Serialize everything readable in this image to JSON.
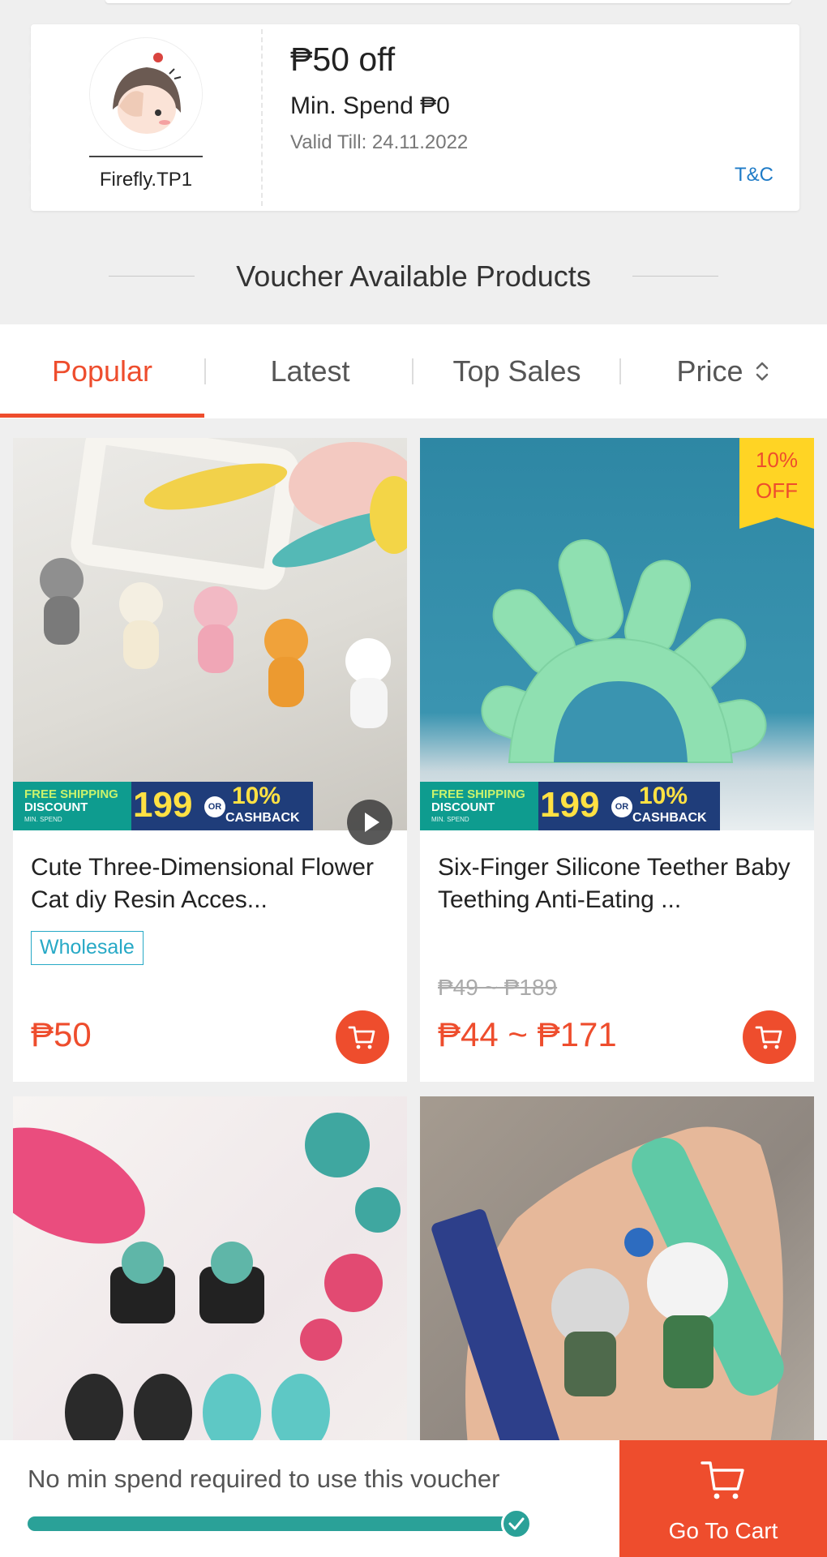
{
  "voucher": {
    "shop_name": "Firefly.TP1",
    "title": "₱50 off",
    "min_spend": "Min. Spend ₱0",
    "valid_till": "Valid Till: 24.11.2022",
    "tnc": "T&C"
  },
  "section": {
    "title": "Voucher Available Products"
  },
  "tabs": {
    "items": [
      {
        "label": "Popular",
        "active": true
      },
      {
        "label": "Latest",
        "active": false
      },
      {
        "label": "Top Sales",
        "active": false
      },
      {
        "label": "Price",
        "active": false
      }
    ],
    "price_icon": "sort-updown-icon"
  },
  "promo_banner": {
    "free_shipping": "FREE SHIPPING",
    "discount": "DISCOUNT",
    "min_spend": "MIN. SPEND",
    "amount": "199",
    "or": "OR",
    "percent": "10%",
    "cashback": "CASHBACK"
  },
  "products": [
    {
      "name": "Cute Three-Dimensional Flower Cat diy Resin Acces...",
      "tag": "Wholesale",
      "price": "₱50",
      "has_video": true
    },
    {
      "name": "Six-Finger Silicone Teether Baby Teething Anti-Eating ...",
      "discount_badge": [
        "10%",
        "OFF"
      ],
      "original_price": "₱49 ~ ₱189",
      "price": "₱44 ~ ₱171"
    },
    {
      "image": "enamel cat cup and bulb charms"
    },
    {
      "image": "Ninja warrios anime keychains"
    }
  ],
  "bottom_bar": {
    "message": "No min spend required to use this voucher",
    "progress": 1.0,
    "go_to_cart": "Go To Cart"
  },
  "colors": {
    "accent": "#ee4d2d",
    "progress": "#2aa198",
    "link": "#1e7bc7",
    "tag": "#27a9c6"
  }
}
